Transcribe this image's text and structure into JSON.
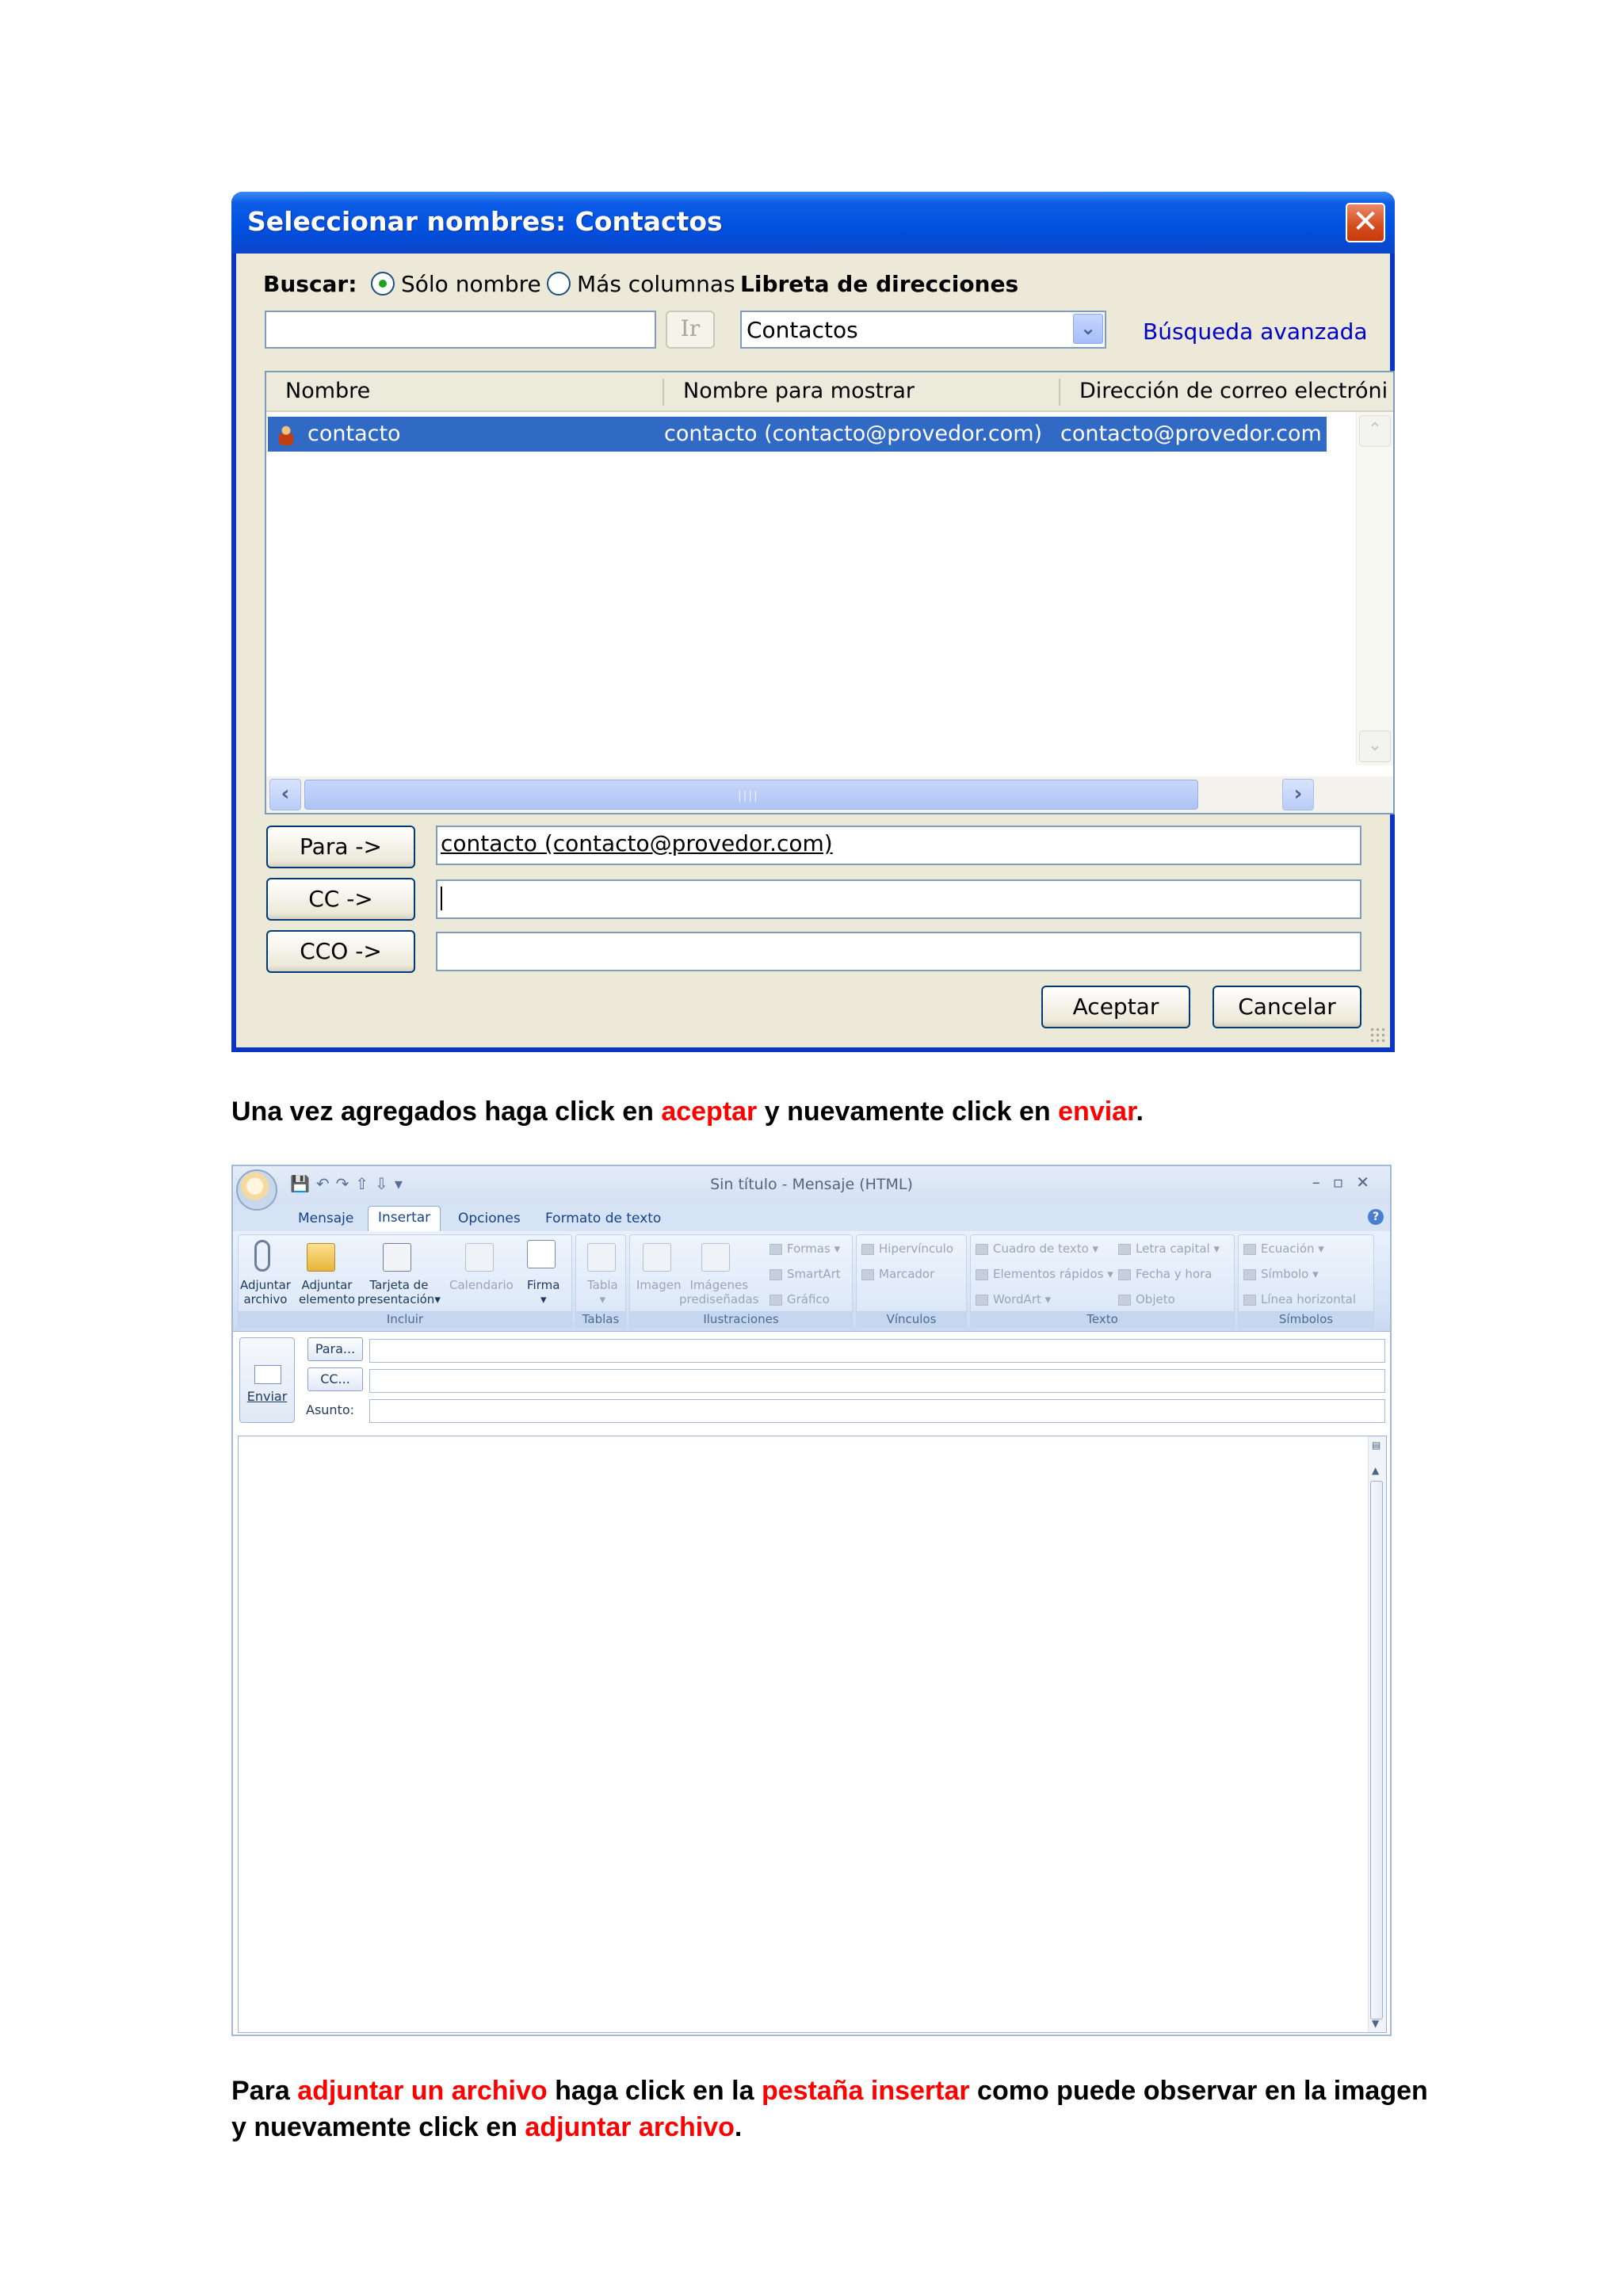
{
  "dialog": {
    "title": "Seleccionar nombres: Contactos",
    "close": "✕",
    "search_label": "Buscar:",
    "radio_name_only": "Sólo nombre",
    "radio_more_columns": "Más columnas",
    "address_book_label": "Libreta de direcciones",
    "go_button": "Ir",
    "address_book_value": "Contactos",
    "advanced_search": "Búsqueda avanzada",
    "columns": [
      "Nombre",
      "Nombre para mostrar",
      "Dirección de correo electróni"
    ],
    "rows": [
      {
        "name": "contacto",
        "display_name": "contacto (contacto@provedor.com)",
        "email": "contacto@provedor.com"
      }
    ],
    "to_button": "Para ->",
    "cc_button": "CC ->",
    "bcc_button": "CCO ->",
    "to_value": "contacto (contacto@provedor.com)",
    "cc_value": "",
    "bcc_value": "",
    "ok_button": "Aceptar",
    "cancel_button": "Cancelar"
  },
  "text1": {
    "part1": "Una vez agregados haga click en ",
    "red1": "aceptar",
    "part2": " y nuevamente click en ",
    "red2": "enviar",
    "part3": "."
  },
  "outlook": {
    "caption": "Sin título - Mensaje (HTML)",
    "tabs": [
      "Mensaje",
      "Insertar",
      "Opciones",
      "Formato de texto"
    ],
    "active_tab": "Insertar",
    "groups": {
      "incluir": "Incluir",
      "tablas": "Tablas",
      "ilustraciones": "Ilustraciones",
      "vinculos": "Vínculos",
      "texto": "Texto",
      "simbolos": "Símbolos"
    },
    "buttons": {
      "adjuntar_archivo_1": "Adjuntar",
      "adjuntar_archivo_2": "archivo",
      "adjuntar_elemento_1": "Adjuntar",
      "adjuntar_elemento_2": "elemento",
      "tarjeta_1": "Tarjeta de",
      "tarjeta_2": "presentación",
      "calendario": "Calendario",
      "firma": "Firma",
      "tabla": "Tabla",
      "imagen": "Imagen",
      "imagenes_1": "Imágenes",
      "imagenes_2": "prediseñadas",
      "formas": "Formas",
      "smartart": "SmartArt",
      "grafico": "Gráfico",
      "hipervinculo": "Hipervínculo",
      "marcador": "Marcador",
      "cuadro_texto": "Cuadro de texto",
      "elementos_rapidos": "Elementos rápidos",
      "wordart": "WordArt",
      "letra_capital": "Letra capital",
      "fecha_hora": "Fecha y hora",
      "objeto": "Objeto",
      "ecuacion": "Ecuación",
      "simbolo": "Símbolo",
      "linea_horizontal": "Línea horizontal"
    },
    "send": "Enviar",
    "to": "Para...",
    "cc": "CC...",
    "subject": "Asunto:"
  },
  "text2": {
    "line1_part1": "Para ",
    "line1_red1": "adjuntar un archivo",
    "line1_part2": " haga click en la ",
    "line1_red2": "pestaña insertar",
    "line1_part3": " como puede observar en la imagen",
    "line2_part1": "y nuevamente click en ",
    "line2_red1": "adjuntar archivo",
    "line2_part2": "."
  }
}
